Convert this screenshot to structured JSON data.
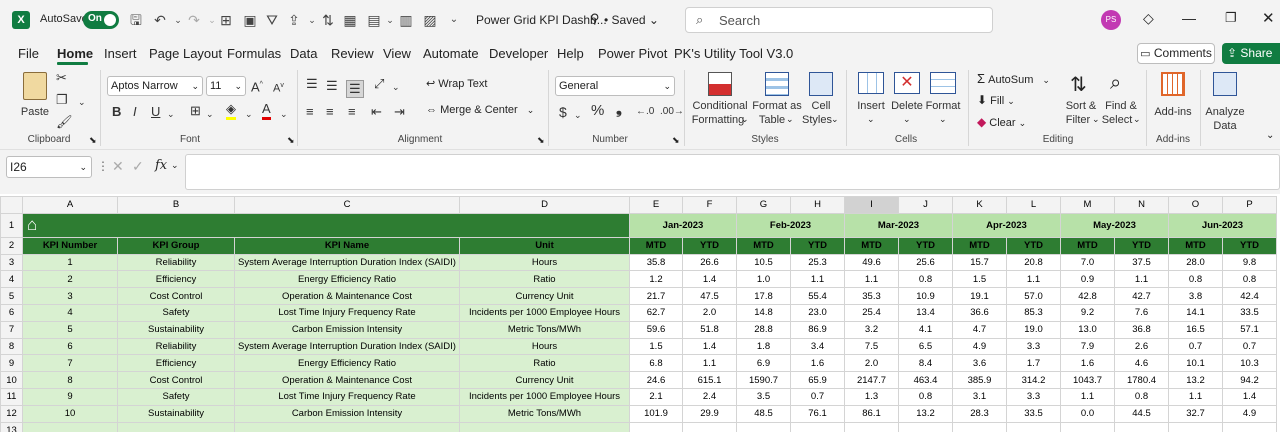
{
  "titlebar": {
    "autosave_label": "AutoSave",
    "autosave_state": "On",
    "doc_title": "Power Grid KPI Dashb...",
    "saved_status": "Saved",
    "search_placeholder": "Search",
    "avatar_initials": "PS"
  },
  "menu": {
    "tabs": [
      "File",
      "Home",
      "Insert",
      "Page Layout",
      "Formulas",
      "Data",
      "Review",
      "View",
      "Automate",
      "Developer",
      "Help",
      "Power Pivot",
      "PK's Utility Tool V3.0"
    ],
    "active": "Home",
    "comments": "Comments",
    "share": "Share"
  },
  "ribbon": {
    "paste": "Paste",
    "clipboard": "Clipboard",
    "font_name": "Aptos Narrow",
    "font_size": "11",
    "font": "Font",
    "wrap_text": "Wrap Text",
    "merge_center": "Merge & Center",
    "alignment": "Alignment",
    "number_format": "General",
    "number": "Number",
    "conditional_formatting_1": "Conditional",
    "conditional_formatting_2": "Formatting",
    "format_as_table_1": "Format as",
    "format_as_table_2": "Table",
    "cell_styles_1": "Cell",
    "cell_styles_2": "Styles",
    "styles": "Styles",
    "insert": "Insert",
    "delete": "Delete",
    "format": "Format",
    "cells": "Cells",
    "autosum": "AutoSum",
    "fill": "Fill",
    "clear": "Clear",
    "sort_filter_1": "Sort &",
    "sort_filter_2": "Filter",
    "find_select_1": "Find &",
    "find_select_2": "Select",
    "editing": "Editing",
    "addins_btn": "Add-ins",
    "addins_grp": "Add-ins",
    "analyze_1": "Analyze",
    "analyze_2": "Data"
  },
  "formula_bar": {
    "name_box": "I26",
    "fx": "fx",
    "content": ""
  },
  "sheet": {
    "columns": [
      "A",
      "B",
      "C",
      "D",
      "E",
      "F",
      "G",
      "H",
      "I",
      "J",
      "K",
      "L",
      "M",
      "N",
      "O",
      "P"
    ],
    "selected_column": "I",
    "row_numbers": [
      "1",
      "2",
      "3",
      "4",
      "5",
      "6",
      "7",
      "8",
      "9",
      "10",
      "11",
      "12",
      "13"
    ],
    "months": [
      "Jan-2023",
      "Feb-2023",
      "Mar-2023",
      "Apr-2023",
      "May-2023",
      "Jun-2023"
    ],
    "headers": [
      "KPI Number",
      "KPI Group",
      "KPI Name",
      "Unit"
    ],
    "sub_headers": [
      "MTD",
      "YTD"
    ],
    "rows": [
      [
        "1",
        "Reliability",
        "System Average Interruption Duration Index (SAIDI)",
        "Hours",
        "35.8",
        "26.6",
        "10.5",
        "25.3",
        "49.6",
        "25.6",
        "15.7",
        "20.8",
        "7.0",
        "37.5",
        "28.0",
        "9.8"
      ],
      [
        "2",
        "Efficiency",
        "Energy Efficiency Ratio",
        "Ratio",
        "1.2",
        "1.4",
        "1.0",
        "1.1",
        "1.1",
        "0.8",
        "1.5",
        "1.1",
        "0.9",
        "1.1",
        "0.8",
        "0.8"
      ],
      [
        "3",
        "Cost Control",
        "Operation & Maintenance Cost",
        "Currency Unit",
        "21.7",
        "47.5",
        "17.8",
        "55.4",
        "35.3",
        "10.9",
        "19.1",
        "57.0",
        "42.8",
        "42.7",
        "3.8",
        "42.4"
      ],
      [
        "4",
        "Safety",
        "Lost Time Injury Frequency Rate",
        "Incidents per 1000 Employee Hours",
        "62.7",
        "2.0",
        "14.8",
        "23.0",
        "25.4",
        "13.4",
        "36.6",
        "85.3",
        "9.2",
        "7.6",
        "14.1",
        "33.5"
      ],
      [
        "5",
        "Sustainability",
        "Carbon Emission Intensity",
        "Metric Tons/MWh",
        "59.6",
        "51.8",
        "28.8",
        "86.9",
        "3.2",
        "4.1",
        "4.7",
        "19.0",
        "13.0",
        "36.8",
        "16.5",
        "57.1"
      ],
      [
        "6",
        "Reliability",
        "System Average Interruption Duration Index (SAIDI)",
        "Hours",
        "1.5",
        "1.4",
        "1.8",
        "3.4",
        "7.5",
        "6.5",
        "4.9",
        "3.3",
        "7.9",
        "2.6",
        "0.7",
        "0.7"
      ],
      [
        "7",
        "Efficiency",
        "Energy Efficiency Ratio",
        "Ratio",
        "6.8",
        "1.1",
        "6.9",
        "1.6",
        "2.0",
        "8.4",
        "3.6",
        "1.7",
        "1.6",
        "4.6",
        "10.1",
        "10.3"
      ],
      [
        "8",
        "Cost Control",
        "Operation & Maintenance Cost",
        "Currency Unit",
        "24.6",
        "615.1",
        "1590.7",
        "65.9",
        "2147.7",
        "463.4",
        "385.9",
        "314.2",
        "1043.7",
        "1780.4",
        "13.2",
        "94.2"
      ],
      [
        "9",
        "Safety",
        "Lost Time Injury Frequency Rate",
        "Incidents per 1000 Employee Hours",
        "2.1",
        "2.4",
        "3.5",
        "0.7",
        "1.3",
        "0.8",
        "3.1",
        "3.3",
        "1.1",
        "0.8",
        "1.1",
        "1.4"
      ],
      [
        "10",
        "Sustainability",
        "Carbon Emission Intensity",
        "Metric Tons/MWh",
        "101.9",
        "29.9",
        "48.5",
        "76.1",
        "86.1",
        "13.2",
        "28.3",
        "33.5",
        "0.0",
        "44.5",
        "32.7",
        "4.9"
      ]
    ]
  },
  "colors": {
    "excel_green": "#107c41",
    "header_green": "#2e7d32",
    "month_green": "#b7e1a8",
    "row_green": "#d9f0d0"
  }
}
